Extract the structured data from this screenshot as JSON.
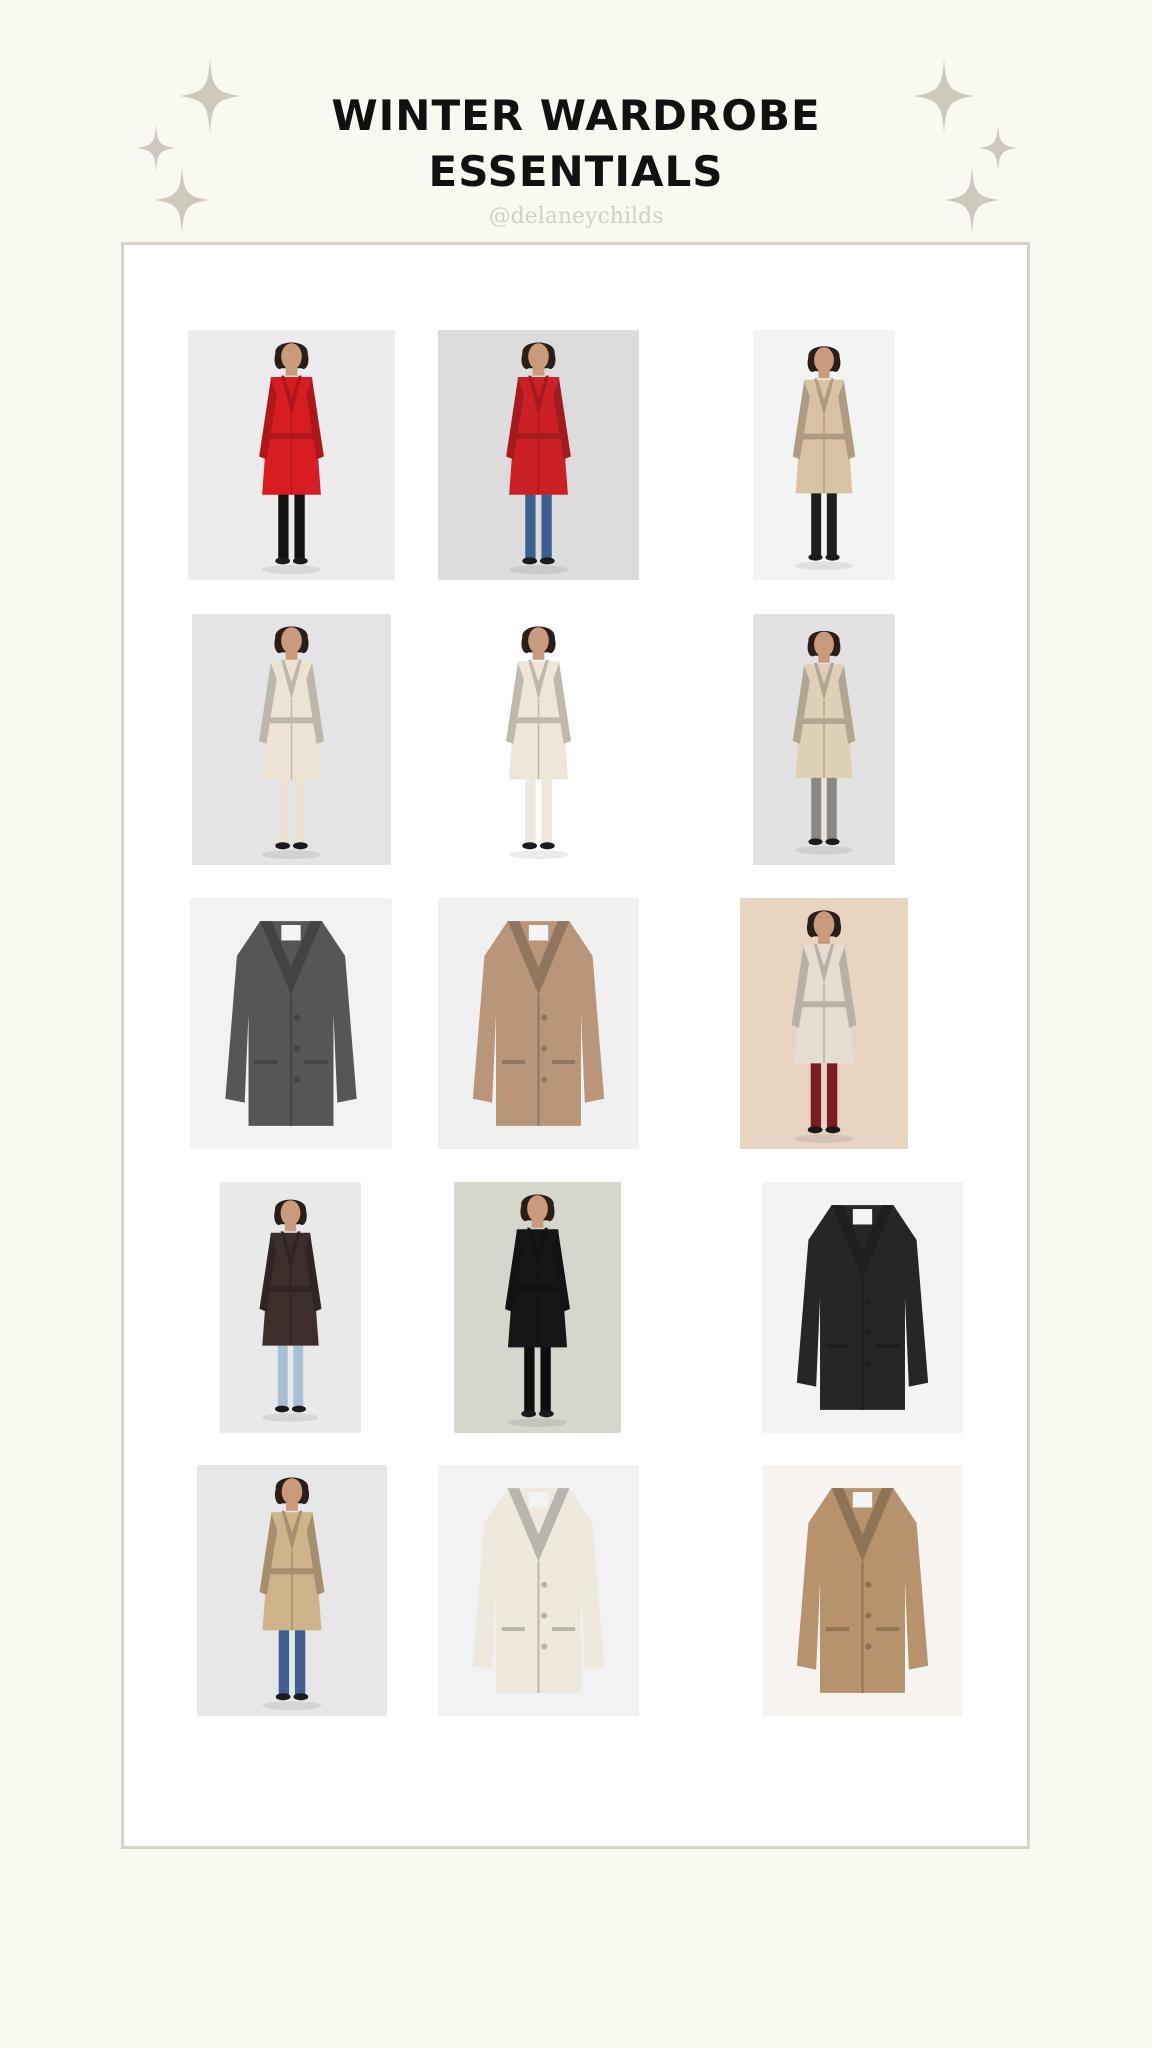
{
  "header": {
    "title_line1": "WINTER WARDROBE",
    "title_line2": "ESSENTIALS",
    "handle": "@delaneychilds"
  },
  "colors": {
    "page_background": "#f9f8f1",
    "board_background": "#ffffff",
    "board_border": "#d8d2c8",
    "sparkle": "#cfc9bd",
    "title": "#111111"
  },
  "products": [
    {
      "name": "red-wrap-coat",
      "kind": "model",
      "coat": "#d81d22",
      "bg": "#ebebed",
      "trousers": "#111111"
    },
    {
      "name": "red-coat-with-jeans",
      "kind": "model",
      "coat": "#cc2027",
      "bg": "#dcdcdd",
      "trousers": "#3c5f8d"
    },
    {
      "name": "camel-coat-seated",
      "kind": "model",
      "coat": "#d9c2a3",
      "bg": "#f3f3f1",
      "trousers": "#1e1e1e"
    },
    {
      "name": "cream-belted-coat",
      "kind": "model",
      "coat": "#ece3d4",
      "bg": "#e4e4e6",
      "trousers": "#e9e2d4"
    },
    {
      "name": "cream-shawl-coat",
      "kind": "model",
      "coat": "#eee6d8",
      "bg": "#ffffff",
      "trousers": "#efe8dc"
    },
    {
      "name": "beige-trench-coat",
      "kind": "model",
      "coat": "#ddd0b7",
      "bg": "#e2e2e2",
      "trousers": "#8c8780"
    },
    {
      "name": "grey-tweed-coat",
      "kind": "product",
      "coat": "#565656",
      "bg": "#f2f2f2"
    },
    {
      "name": "camel-single-breasted-coat",
      "kind": "product",
      "coat": "#b9967a",
      "bg": "#f0f0f0"
    },
    {
      "name": "oatmeal-coat-burgundy-dress",
      "kind": "model",
      "coat": "#e6ddd2",
      "bg": "#e7d5c2",
      "trousers": "#7b1d24"
    },
    {
      "name": "brown-long-coat",
      "kind": "model",
      "coat": "#3b2e2b",
      "bg": "#e9e9ea",
      "trousers": "#a8bfd4"
    },
    {
      "name": "black-long-coat",
      "kind": "model",
      "coat": "#161616",
      "bg": "#d5d6cc",
      "trousers": "#0e0e0e"
    },
    {
      "name": "black-leather-trench",
      "kind": "product",
      "coat": "#262626",
      "bg": "#f3f3f3"
    },
    {
      "name": "camel-coat-with-jeans",
      "kind": "model",
      "coat": "#cfb38a",
      "bg": "#e7e7e8",
      "trousers": "#3f5f8f"
    },
    {
      "name": "ivory-long-coat",
      "kind": "product",
      "coat": "#eee8dd",
      "bg": "#f2f2f2"
    },
    {
      "name": "camel-short-coat",
      "kind": "product",
      "coat": "#b7936d",
      "bg": "#f6f3f0"
    }
  ]
}
